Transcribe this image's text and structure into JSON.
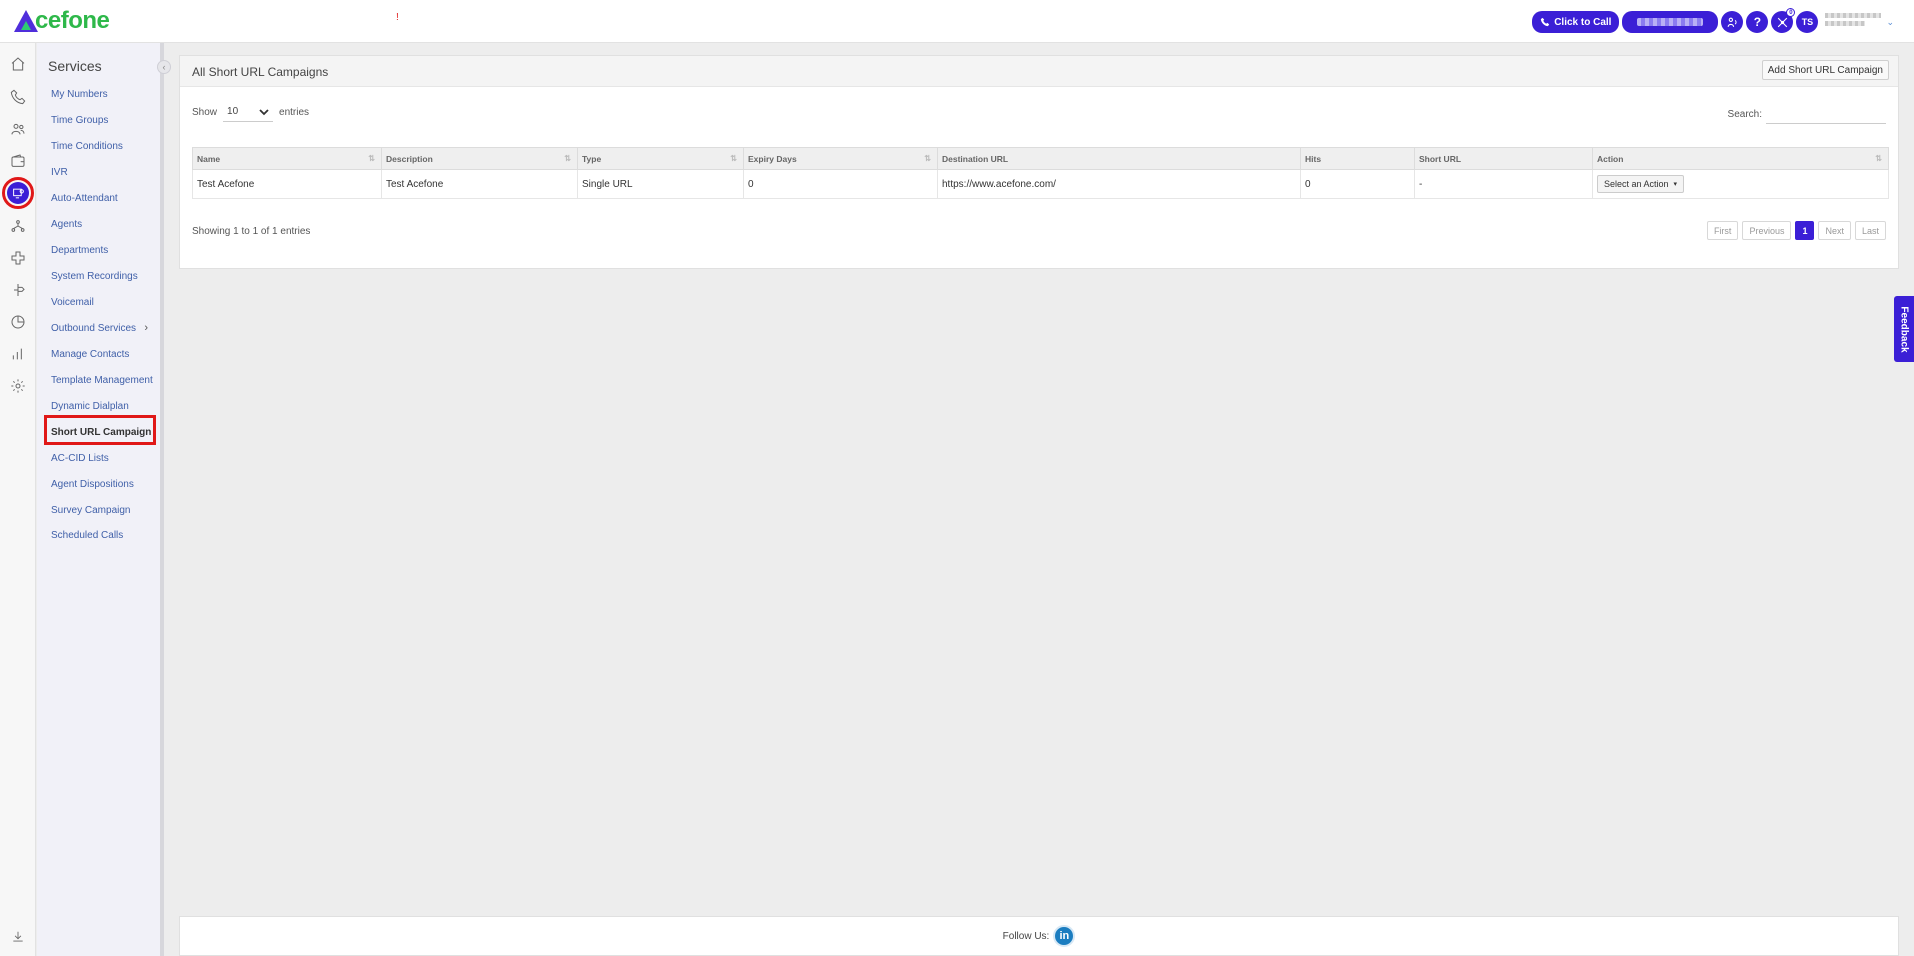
{
  "header": {
    "logo_text": "cefone",
    "alert_mark": "!",
    "click_to_call": "Click to Call",
    "help": "?",
    "avatar_initials": "TS",
    "notification_count": "0"
  },
  "rail": {
    "icons": [
      "home-icon",
      "phone-icon",
      "users-icon",
      "wallet-icon",
      "services-icon",
      "network-icon",
      "integrations-icon",
      "routing-icon",
      "reports-icon",
      "analytics-icon",
      "settings-icon",
      "download-icon"
    ],
    "active": "services-icon"
  },
  "services": {
    "title": "Services",
    "items": [
      {
        "label": "My Numbers"
      },
      {
        "label": "Time Groups"
      },
      {
        "label": "Time Conditions"
      },
      {
        "label": "IVR"
      },
      {
        "label": "Auto-Attendant"
      },
      {
        "label": "Agents"
      },
      {
        "label": "Departments"
      },
      {
        "label": "System Recordings"
      },
      {
        "label": "Voicemail"
      },
      {
        "label": "Outbound Services"
      },
      {
        "label": "Manage Contacts"
      },
      {
        "label": "Template Management"
      },
      {
        "label": "Dynamic Dialplan"
      },
      {
        "label": "Short URL Campaign"
      },
      {
        "label": "AC-CID Lists"
      },
      {
        "label": "Agent Dispositions"
      },
      {
        "label": "Survey Campaign"
      },
      {
        "label": "Scheduled Calls"
      }
    ],
    "active_item": "Short URL Campaign"
  },
  "panel": {
    "title": "All Short URL Campaigns",
    "add_button": "Add Short URL Campaign",
    "show_label": "Show",
    "show_value": "10",
    "entries_label": "entries",
    "search_label": "Search:",
    "search_value": ""
  },
  "table": {
    "columns": [
      "Name",
      "Description",
      "Type",
      "Expiry Days",
      "Destination URL",
      "Hits",
      "Short URL",
      "Action"
    ],
    "rows": [
      {
        "name": "Test Acefone",
        "description": "Test Acefone",
        "type": "Single URL",
        "expiry_days": "0",
        "destination_url": "https://www.acefone.com/",
        "hits": "0",
        "short_url": "-",
        "action": "Select an Action"
      }
    ]
  },
  "pagination": {
    "summary": "Showing 1 to 1 of 1 entries",
    "first": "First",
    "previous": "Previous",
    "current": "1",
    "next": "Next",
    "last": "Last"
  },
  "feedback": "Feedback",
  "footer": {
    "follow_us": "Follow Us:",
    "linkedin": "in"
  }
}
